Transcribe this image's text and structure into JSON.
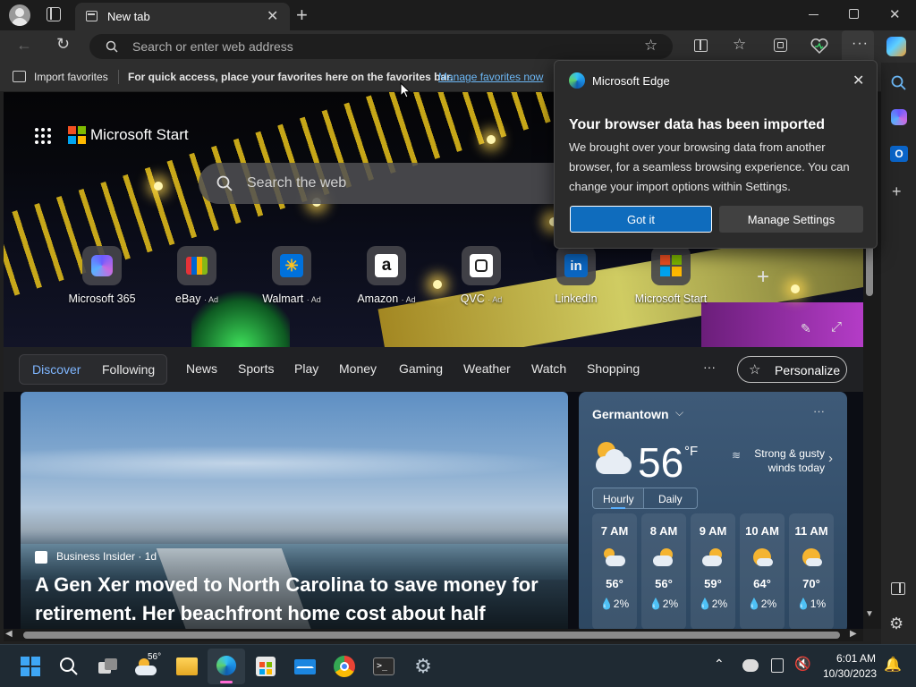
{
  "browser": {
    "tab_title": "New tab",
    "address_placeholder": "Search or enter web address"
  },
  "favorites_bar": {
    "import_label": "Import favorites",
    "hint": "For quick access, place your favorites here on the favorites bar.",
    "manage_link": "Manage favorites now"
  },
  "start": {
    "brand": "Microsoft Start",
    "search_placeholder": "Search the web"
  },
  "quick_links": [
    {
      "label": "Microsoft 365",
      "ad": ""
    },
    {
      "label": "eBay",
      "ad": "· Ad"
    },
    {
      "label": "Walmart",
      "ad": "· Ad"
    },
    {
      "label": "Amazon",
      "ad": "· Ad"
    },
    {
      "label": "QVC",
      "ad": "· Ad"
    },
    {
      "label": "LinkedIn",
      "ad": ""
    },
    {
      "label": "Microsoft Start",
      "ad": ""
    }
  ],
  "nav": {
    "discover": "Discover",
    "following": "Following",
    "items": [
      "News",
      "Sports",
      "Play",
      "Money",
      "Gaming",
      "Weather",
      "Watch",
      "Shopping"
    ],
    "more": "···",
    "personalize": "Personalize"
  },
  "news_card": {
    "source": "Business Insider · 1d",
    "headline": "A Gen Xer moved to North Carolina to save money for retirement. Her beachfront home cost about half"
  },
  "weather": {
    "location": "Germantown",
    "temperature": "56",
    "unit": "°F",
    "alert": "Strong & gusty winds today",
    "tab_hourly": "Hourly",
    "tab_daily": "Daily",
    "hourly": [
      {
        "time": "7 AM",
        "temp": "56°",
        "precip": "2%",
        "icon": "partly-cloudy-night-icon"
      },
      {
        "time": "8 AM",
        "temp": "56°",
        "precip": "2%",
        "icon": "partly-cloudy-icon"
      },
      {
        "time": "9 AM",
        "temp": "59°",
        "precip": "2%",
        "icon": "partly-cloudy-icon"
      },
      {
        "time": "10 AM",
        "temp": "64°",
        "precip": "2%",
        "icon": "sun-cloud-icon"
      },
      {
        "time": "11 AM",
        "temp": "70°",
        "precip": "1%",
        "icon": "sun-cloud-icon"
      }
    ]
  },
  "popup": {
    "app_name": "Microsoft Edge",
    "title": "Your browser data has been imported",
    "body": "We brought over your browsing data from another browser, for a seamless browsing experience. You can change your import options within Settings.",
    "primary_button": "Got it",
    "secondary_button": "Manage Settings"
  },
  "taskbar": {
    "weather_temp": "56°",
    "time": "6:01 AM",
    "date": "10/30/2023"
  },
  "colors": {
    "accent": "#0f6cbd",
    "link": "#6cb8f6",
    "discover": "#7fb6ff"
  }
}
